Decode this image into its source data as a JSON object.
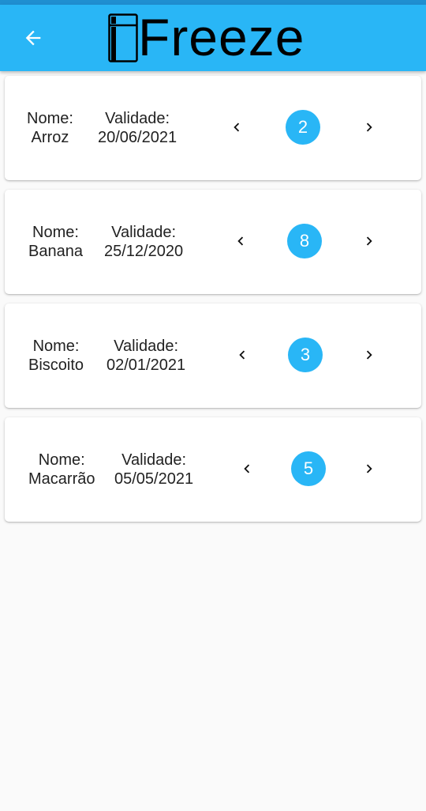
{
  "app": {
    "logo_text": "Freeze",
    "logo_prefix": "i",
    "accent_color": "#29b6f6"
  },
  "toolbar": {
    "back_icon": "arrow-left-icon"
  },
  "items": [
    {
      "nome_label": "Nome:",
      "nome": "Arroz",
      "validade_label": "Validade:",
      "validade": "20/06/2021",
      "quantidade": "2"
    },
    {
      "nome_label": "Nome:",
      "nome": "Banana",
      "validade_label": "Validade:",
      "validade": "25/12/2020",
      "quantidade": "8"
    },
    {
      "nome_label": "Nome:",
      "nome": "Biscoito",
      "validade_label": "Validade:",
      "validade": "02/01/2021",
      "quantidade": "3"
    },
    {
      "nome_label": "Nome:",
      "nome": "Macarrão",
      "validade_label": "Validade:",
      "validade": "05/05/2021",
      "quantidade": "5"
    }
  ]
}
